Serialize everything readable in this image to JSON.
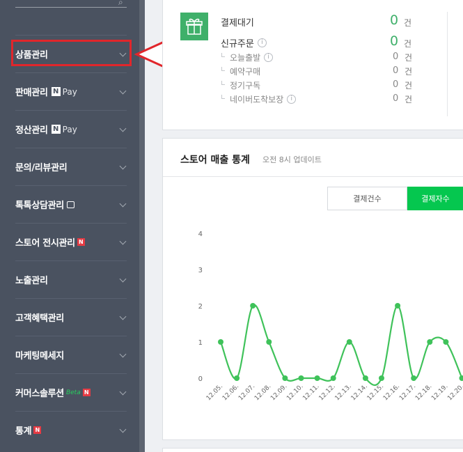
{
  "sidebar": {
    "search_icon": "search-icon",
    "items": [
      {
        "label": "상품관리"
      },
      {
        "label": "판매관리",
        "badge_n": "N",
        "badge_pay": "Pay"
      },
      {
        "label": "정산관리",
        "badge_n": "N",
        "badge_pay": "Pay"
      },
      {
        "label": "문의/리뷰관리"
      },
      {
        "label": "톡톡상담관리"
      },
      {
        "label": "스토어 전시관리",
        "new": "N"
      },
      {
        "label": "노출관리"
      },
      {
        "label": "고객혜택관리"
      },
      {
        "label": "마케팅메세지"
      },
      {
        "label": "커머스솔루션",
        "beta": "Beta",
        "new": "N"
      },
      {
        "label": "통계",
        "new": "N"
      }
    ]
  },
  "annotation": {
    "color": "#e1262b"
  },
  "orders": {
    "pending": {
      "label": "결제대기",
      "value": "0",
      "unit": "건"
    },
    "new": {
      "label": "신규주문",
      "info": "i",
      "value": "0",
      "unit": "건"
    },
    "subs": [
      {
        "label": "오늘출발",
        "info": "i",
        "value": "0",
        "unit": "건"
      },
      {
        "label": "예약구매",
        "value": "0",
        "unit": "건"
      },
      {
        "label": "정기구독",
        "value": "0",
        "unit": "건"
      },
      {
        "label": "네이버도착보장",
        "info": "i",
        "value": "0",
        "unit": "건"
      }
    ]
  },
  "stats": {
    "title": "스토어 매출 통계",
    "updated": "오전 8시 업데이트",
    "tab_count": "결제건수",
    "tab_buyers": "결제자수"
  },
  "chart_data": {
    "type": "line",
    "categories": [
      "12.05.",
      "12.06.",
      "12.07.",
      "12.08.",
      "12.09.",
      "12.10.",
      "12.11.",
      "12.12.",
      "12.13.",
      "12.14.",
      "12.15.",
      "12.16.",
      "12.17.",
      "12.18.",
      "12.19.",
      "12.20."
    ],
    "values": [
      1,
      0,
      2,
      1,
      0,
      0,
      0,
      0,
      1,
      0,
      0,
      2,
      0,
      1,
      1,
      0
    ],
    "ylim": [
      0,
      4
    ],
    "yticks": [
      "0",
      "1",
      "2",
      "3",
      "4"
    ],
    "color": "#3fc25a",
    "grid": false
  }
}
